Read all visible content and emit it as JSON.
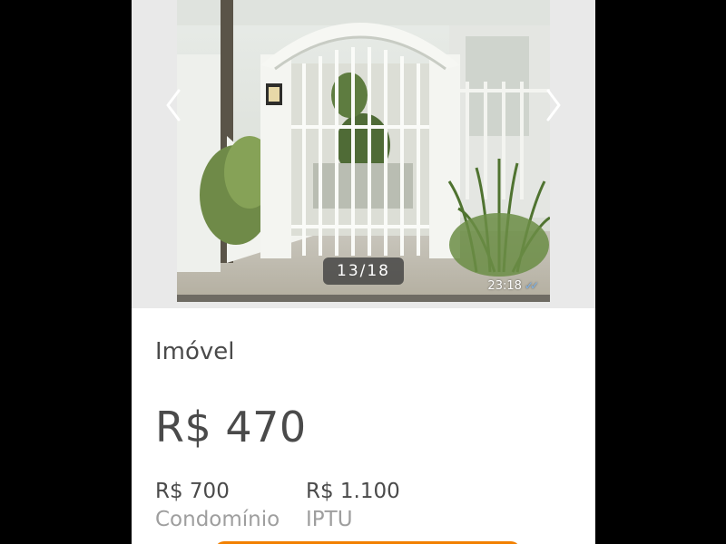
{
  "gallery": {
    "counter": "13/18",
    "photo_timestamp": "23:18",
    "prev_icon": "chevron-left-icon",
    "next_icon": "chevron-right-icon"
  },
  "listing": {
    "category": "Imóvel",
    "price": "R$ 470",
    "fees": [
      {
        "value": "R$ 700",
        "label": "Condomínio"
      },
      {
        "value": "R$ 1.100",
        "label": "IPTU"
      }
    ]
  },
  "colors": {
    "accent": "#f28000",
    "text_primary": "#4a4a4a",
    "text_secondary": "#9e9e9e",
    "gallery_background": "#e9e9e9",
    "page_background": "#000000"
  }
}
